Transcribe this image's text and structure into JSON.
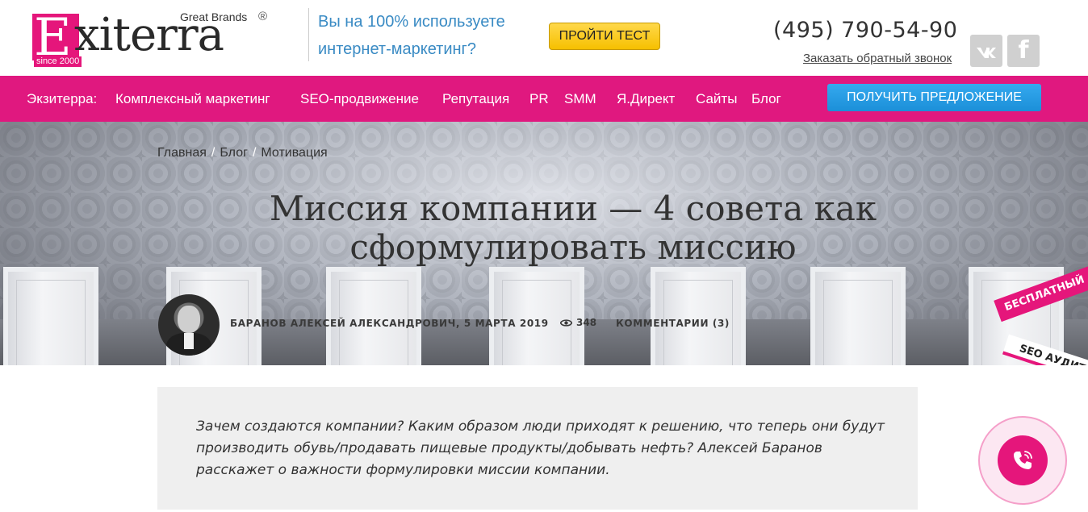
{
  "header": {
    "logo": {
      "initial": "E",
      "rest": "xiterra",
      "tagline": "Great Brands",
      "registered": "®",
      "since": "since 2000"
    },
    "promo": "Вы на 100% используете интернет-маркетинг?",
    "test_button": "ПРОЙТИ ТЕСТ",
    "phone": "(495) 790-54-90",
    "callback": "Заказать обратный звонок",
    "social": {
      "vk": "vk",
      "fb": "f"
    }
  },
  "nav": {
    "brand": "Экзитерра:",
    "items": [
      {
        "label": "Комплексный маркетинг"
      },
      {
        "label": "SEO-продвижение"
      },
      {
        "label": "Репутация"
      },
      {
        "label": "PR"
      },
      {
        "label": "SMM"
      },
      {
        "label": "Я.Директ"
      },
      {
        "label": "Сайты"
      },
      {
        "label": "Блог"
      }
    ],
    "offer_button": "ПОЛУЧИТЬ ПРЕДЛОЖЕНИЕ"
  },
  "hero": {
    "breadcrumb": [
      "Главная",
      "Блог",
      "Мотивация"
    ],
    "breadcrumb_sep": "/",
    "title_line1": "Миссия компании — 4 совета как",
    "title_line2": "сформулировать миссию",
    "author_date": "БАРАНОВ АЛЕКСЕЙ АЛЕКСАНДРОВИЧ, 5 МАРТА 2019",
    "views": "348",
    "comments": "КОММЕНТАРИИ (3)",
    "ribbon_top": "БЕСПЛАТНЫЙ",
    "ribbon_bottom": "SEO АУДИТ"
  },
  "lead": {
    "text": "Зачем создаются компании? Каким образом люди приходят к решению, что теперь они будут производить обувь/продавать пищевые  продукты/добывать нефть? Алексей Баранов расскажет о важности формулировки миссии компании."
  },
  "colors": {
    "brand_pink": "#e0187f",
    "accent_blue": "#1b8fd8",
    "cta_yellow": "#f6c000",
    "promo_blue": "#3a8bc4"
  },
  "icons": {
    "views": "eye-icon",
    "call": "phone-icon",
    "vk": "vk-icon",
    "fb": "facebook-icon"
  }
}
